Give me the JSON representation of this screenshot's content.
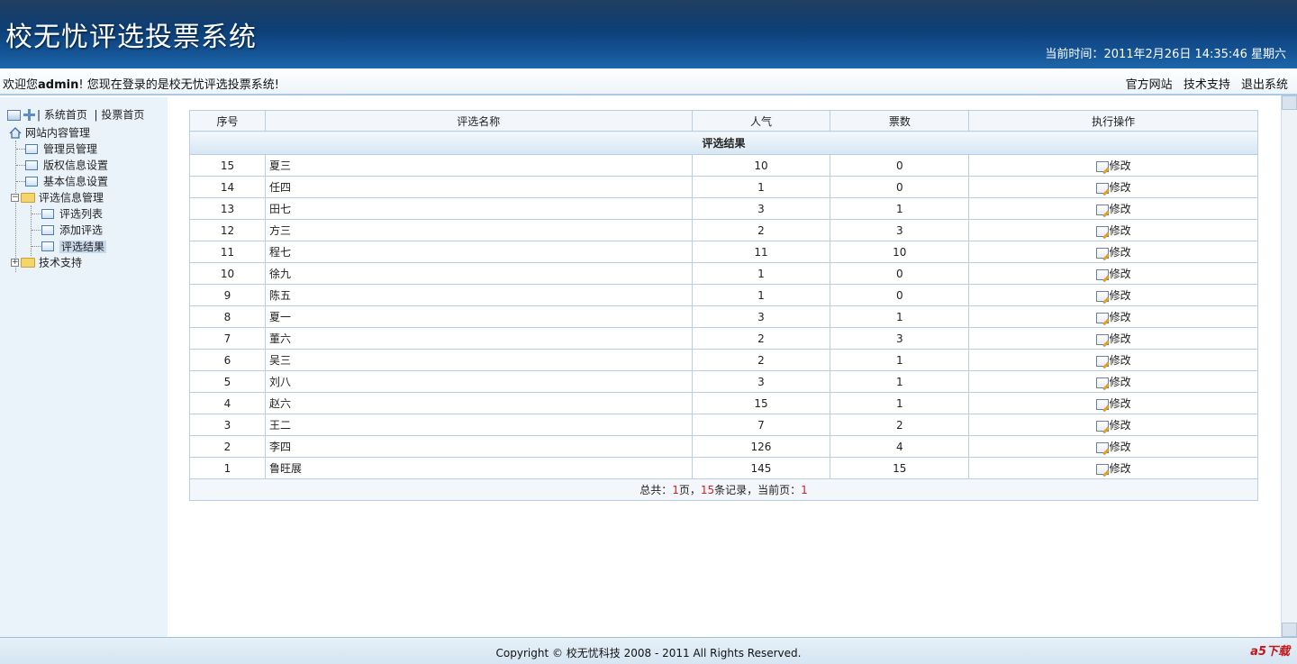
{
  "header": {
    "title": "校无忧评选投票系统",
    "time_label": "当前时间：",
    "time_value": "2011年2月26日  14:35:46 星期六"
  },
  "welcome": {
    "prefix": "欢迎您",
    "user": "admin",
    "suffix": "! 您现在登录的是校无忧评选投票系统!",
    "links": [
      "官方网站",
      "技术支持",
      "退出系统"
    ]
  },
  "sidebar": {
    "top_links": [
      "| 系统首页",
      "| 投票首页"
    ],
    "root": "网站内容管理",
    "items": [
      "管理员管理",
      "版权信息设置",
      "基本信息设置",
      "评选信息管理",
      "评选列表",
      "添加评选",
      "评选结果",
      "技术支持"
    ],
    "selected": "评选结果"
  },
  "table": {
    "caption": "评选结果",
    "headers": [
      "序号",
      "评选名称",
      "人气",
      "票数",
      "执行操作"
    ],
    "edit_label": "修改",
    "rows": [
      {
        "id": "15",
        "name": "夏三",
        "pop": "10",
        "votes": "0"
      },
      {
        "id": "14",
        "name": "任四",
        "pop": "1",
        "votes": "0"
      },
      {
        "id": "13",
        "name": "田七",
        "pop": "3",
        "votes": "1"
      },
      {
        "id": "12",
        "name": "方三",
        "pop": "2",
        "votes": "3"
      },
      {
        "id": "11",
        "name": "程七",
        "pop": "11",
        "votes": "10"
      },
      {
        "id": "10",
        "name": "徐九",
        "pop": "1",
        "votes": "0"
      },
      {
        "id": "9",
        "name": "陈五",
        "pop": "1",
        "votes": "0"
      },
      {
        "id": "8",
        "name": "夏一",
        "pop": "3",
        "votes": "1"
      },
      {
        "id": "7",
        "name": "董六",
        "pop": "2",
        "votes": "3"
      },
      {
        "id": "6",
        "name": "吴三",
        "pop": "2",
        "votes": "1"
      },
      {
        "id": "5",
        "name": "刘八",
        "pop": "3",
        "votes": "1"
      },
      {
        "id": "4",
        "name": "赵六",
        "pop": "15",
        "votes": "1"
      },
      {
        "id": "3",
        "name": "王二",
        "pop": "7",
        "votes": "2"
      },
      {
        "id": "2",
        "name": "李四",
        "pop": "126",
        "votes": "4"
      },
      {
        "id": "1",
        "name": "鲁旺展",
        "pop": "145",
        "votes": "15"
      }
    ],
    "footer": {
      "total_label": "总共：",
      "pages": "1",
      "pages_unit": "页，",
      "records": "15",
      "records_unit": "条记录，当前页：",
      "current": "1"
    }
  },
  "footer": {
    "copyright": "Copyright © 校无忧科技  2008 - 2011 All Rights Reserved.",
    "watermark": "a5下载"
  }
}
